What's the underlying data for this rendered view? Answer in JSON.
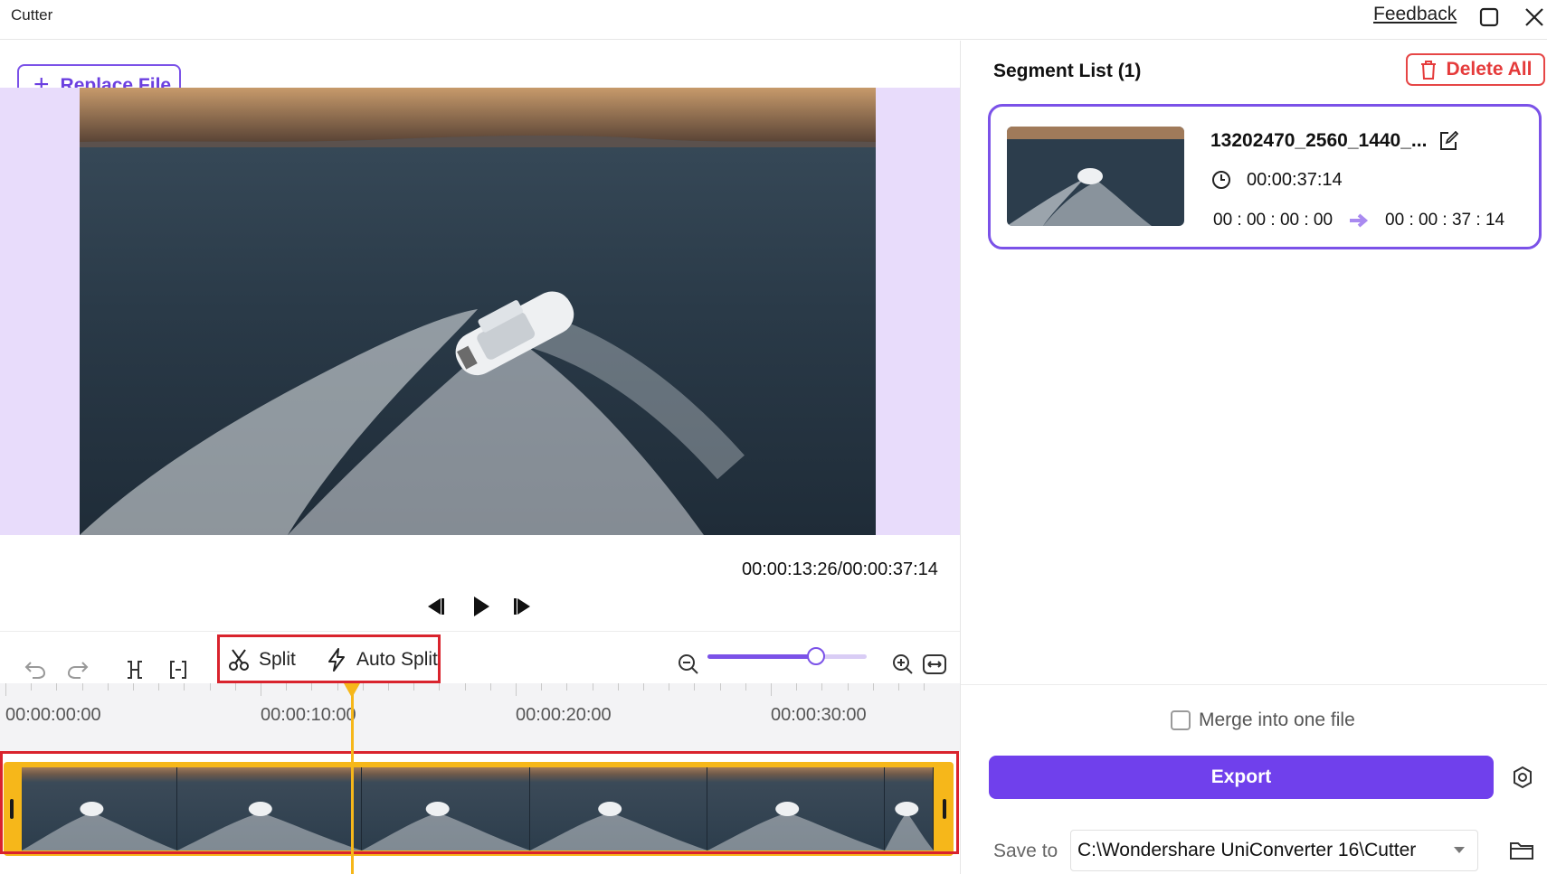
{
  "window": {
    "title": "Cutter",
    "feedback_label": "Feedback"
  },
  "left": {
    "replace_file_label": "Replace File",
    "timecode": "00:00:13:26/00:00:37:14",
    "tools": {
      "split_label": "Split",
      "auto_split_label": "Auto Split"
    },
    "zoom_level": 0.68,
    "ruler_labels": [
      "00:00:00:00",
      "00:00:10:00",
      "00:00:20:00",
      "00:00:30:00"
    ]
  },
  "right": {
    "segment_list_title": "Segment List (1)",
    "delete_all_label": "Delete All",
    "segment": {
      "name": "13202470_2560_1440_...",
      "duration": "00:00:37:14",
      "start": "00 : 00 : 00 : 00",
      "end": "00 : 00 : 37 : 14"
    },
    "merge_label": "Merge into one file",
    "merge_checked": false,
    "export_label": "Export",
    "save_to_label": "Save to",
    "save_path": "C:\\Wondershare UniConverter 16\\Cutter"
  },
  "colors": {
    "accent": "#7040ec",
    "highlight": "#d9232d",
    "timeline": "#f6b71a",
    "danger": "#e53b3b"
  }
}
